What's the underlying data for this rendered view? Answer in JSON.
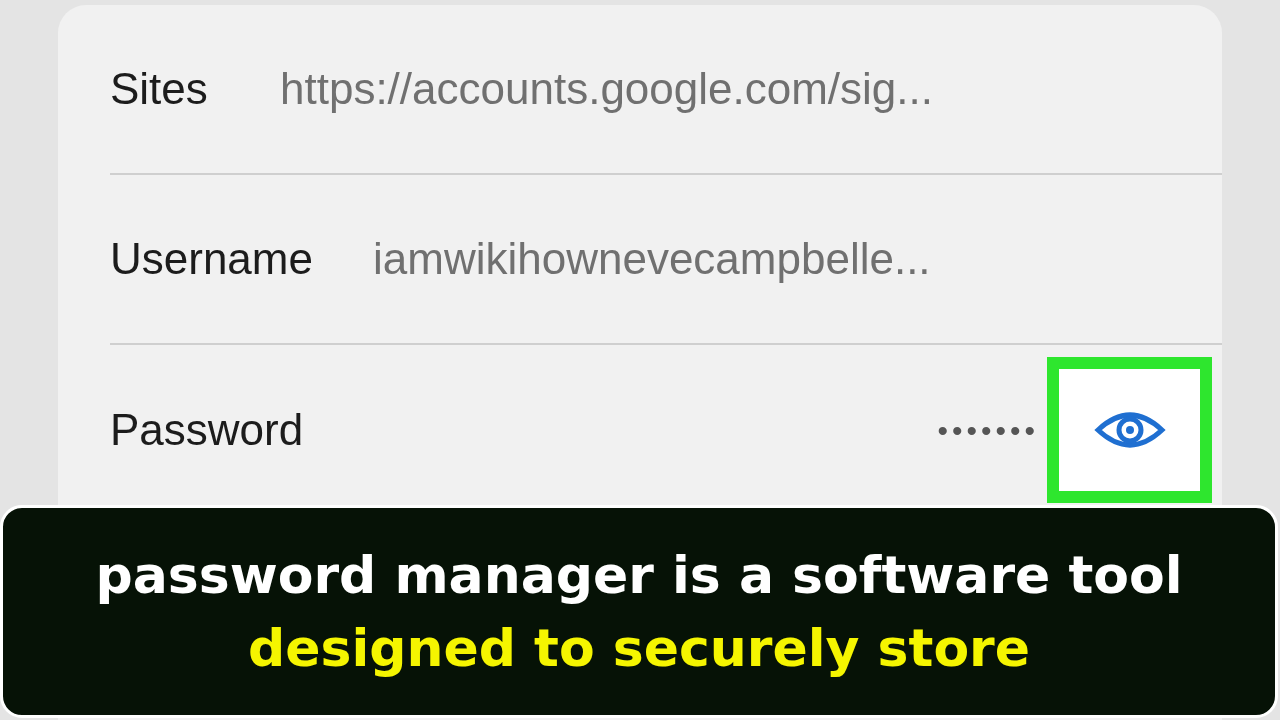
{
  "rows": [
    {
      "label": "Sites",
      "value": "https://accounts.google.com/sig...",
      "kind": "text"
    },
    {
      "label": "Username",
      "value": "iamwikihownevecampbelle...",
      "kind": "text"
    },
    {
      "label": "Password",
      "value": "•••••••",
      "kind": "secret",
      "highlighted": true
    }
  ],
  "caption": {
    "line_1": "password manager is a software tool",
    "line_2": "designed to securely store"
  }
}
